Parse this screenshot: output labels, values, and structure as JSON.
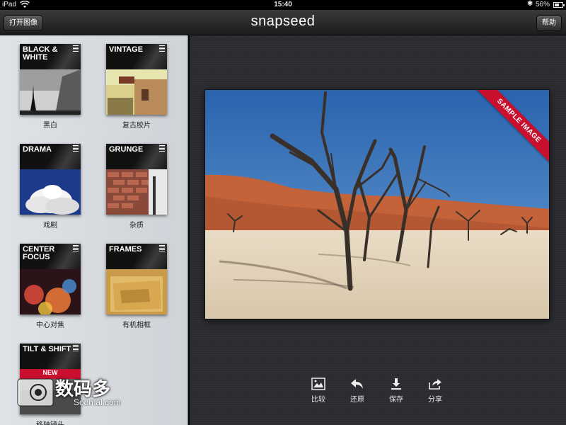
{
  "status": {
    "carrier": "iPad",
    "time": "15:40",
    "bluetooth": "✱",
    "battery_percent": "56%",
    "battery_level": 0.56
  },
  "navbar": {
    "open_label": "打开图像",
    "brand": "snapseed",
    "help_label": "帮助"
  },
  "filters": [
    {
      "title": "BLACK & WHITE",
      "label": "黑白"
    },
    {
      "title": "VINTAGE",
      "label": "复古胶片"
    },
    {
      "title": "DRAMA",
      "label": "戏剧"
    },
    {
      "title": "GRUNGE",
      "label": "杂质"
    },
    {
      "title": "CENTER FOCUS",
      "label": "中心对焦"
    },
    {
      "title": "FRAMES",
      "label": "有机相框"
    },
    {
      "title": "TILT & SHIFT",
      "label": "移轴镜头",
      "badge": "NEW"
    }
  ],
  "photo": {
    "ribbon": "SAMPLE IMAGE"
  },
  "toolbar": {
    "compare": "比较",
    "revert": "还原",
    "save": "保存",
    "share": "分享"
  },
  "watermark": {
    "cn": "数码多",
    "url": "Soomal.com"
  },
  "colors": {
    "ribbon": "#c8102e",
    "sky": "#2f6db3",
    "dune": "#c5623a",
    "sand": "#e2d3bd"
  }
}
